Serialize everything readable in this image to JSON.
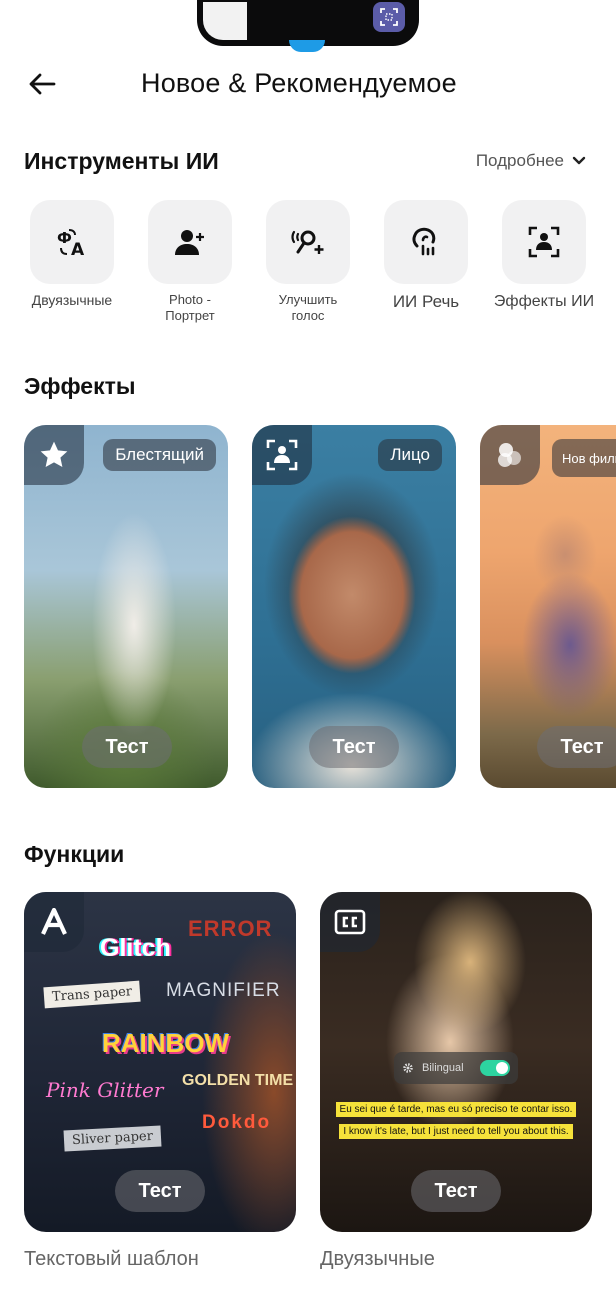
{
  "header": {
    "title": "Новое & Рекомендуемое"
  },
  "ai_tools": {
    "title": "Инструменты ИИ",
    "more_label": "Подробнее",
    "items": [
      {
        "label": "Двуязычные",
        "icon": "translate-icon"
      },
      {
        "label": "Photo - Портрет",
        "icon": "add-person-icon"
      },
      {
        "label": "Улучшить голос",
        "icon": "voice-enhance-icon"
      },
      {
        "label": "ИИ Речь",
        "icon": "ai-speech-icon"
      },
      {
        "label": "Эффекты ИИ",
        "icon": "ai-effects-icon"
      }
    ]
  },
  "effects": {
    "title": "Эффекты",
    "cards": [
      {
        "tag": "Блестящий",
        "button": "Тест",
        "icon": "star-icon"
      },
      {
        "tag": "Лицо",
        "button": "Тест",
        "icon": "face-detect-icon"
      },
      {
        "tag": "Нов фильт",
        "button": "Тест",
        "icon": "filter-circles-icon"
      }
    ]
  },
  "functions": {
    "title": "Функции",
    "cards": [
      {
        "caption": "Текстовый шаблон",
        "button": "Тест",
        "icon": "text-a-icon",
        "samples": [
          "ERROR",
          "Glitch",
          "Trans paper",
          "MAGNIFIER",
          "RAINBOW",
          "Pink Glitter",
          "GOLDEN TIME",
          "Dokdo",
          "Sliver paper"
        ]
      },
      {
        "caption": "Двуязычные",
        "button": "Тест",
        "icon": "captions-icon",
        "toggle_label": "Bilingual",
        "subtitle_1": "Eu sei que é tarde, mas eu só preciso te contar isso.",
        "subtitle_2": "I know it's late, but I just need to tell you about this."
      }
    ]
  }
}
